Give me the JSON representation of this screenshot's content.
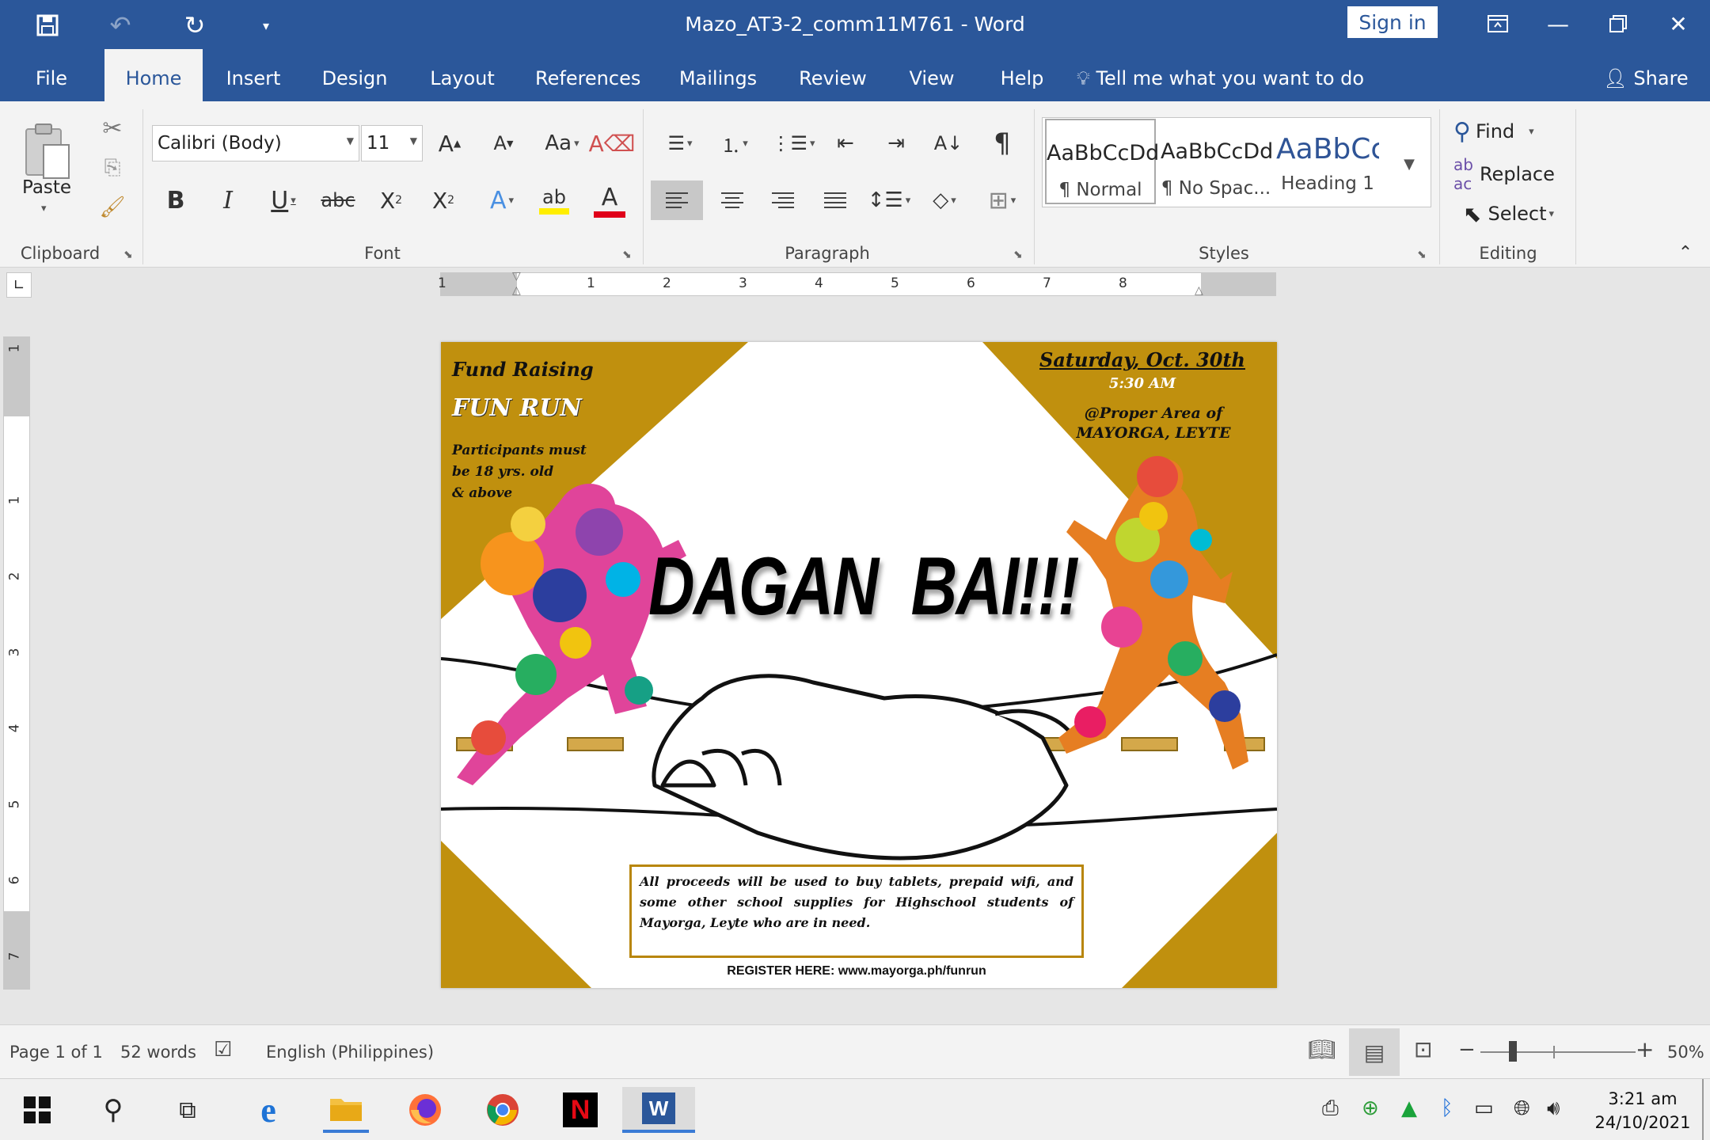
{
  "title_bar": {
    "document_title": "Mazo_AT3-2_comm11M761  -  Word",
    "sign_in_label": "Sign in",
    "quick_access": [
      "save-icon",
      "undo-icon",
      "redo-icon",
      "customize-qat-icon"
    ],
    "window_controls": [
      "ribbon-display-icon",
      "minimize-icon",
      "restore-icon",
      "close-icon"
    ]
  },
  "tabs": {
    "items": [
      "File",
      "Home",
      "Insert",
      "Design",
      "Layout",
      "References",
      "Mailings",
      "Review",
      "View",
      "Help"
    ],
    "active": "Home",
    "tell_me": "Tell me what you want to do",
    "share": "Share"
  },
  "ribbon": {
    "clipboard": {
      "label": "Clipboard",
      "paste_label": "Paste"
    },
    "font": {
      "label": "Font",
      "font_name": "Calibri (Body)",
      "font_size": "11"
    },
    "paragraph": {
      "label": "Paragraph"
    },
    "styles": {
      "label": "Styles",
      "items": [
        {
          "sample": "AaBbCcDd",
          "name": "¶ Normal"
        },
        {
          "sample": "AaBbCcDd",
          "name": "¶ No Spac..."
        },
        {
          "sample": "AaBbCc",
          "name": "Heading 1"
        }
      ]
    },
    "editing": {
      "label": "Editing",
      "find": "Find",
      "replace": "Replace",
      "select": "Select"
    }
  },
  "ruler": {
    "h_numbers": [
      "1",
      "1",
      "2",
      "3",
      "4",
      "5",
      "6",
      "7",
      "8"
    ],
    "v_numbers": [
      "1",
      "1",
      "2",
      "3",
      "4",
      "5",
      "6",
      "7"
    ]
  },
  "flyer": {
    "fund_raising": "Fund Raising",
    "fun_run": "FUN RUN",
    "participants": [
      "Participants must",
      "be 18 yrs. old",
      "& above"
    ],
    "date": "Saturday, Oct. 30th",
    "time": "5:30 AM",
    "venue": [
      "@Proper Area of",
      "MAYORGA, LEYTE"
    ],
    "headline": "DAGAN  BAI!!!",
    "proceeds": "All proceeds will be used to buy tablets, prepaid wifi, and some other school supplies for Highschool students of Mayorga, Leyte who are in need.",
    "register": "REGISTER HERE: www.mayorga.ph/funrun",
    "colors": {
      "gold": "#c0900e",
      "black": "#111111"
    }
  },
  "status_bar": {
    "page": "Page 1 of 1",
    "words": "52 words",
    "language": "English (Philippines)",
    "zoom_percent": "50%",
    "zoom_value": 50
  },
  "taskbar": {
    "apps": [
      "windows-start-icon",
      "search-icon",
      "task-view-icon",
      "edge-icon",
      "file-explorer-icon",
      "firefox-icon",
      "chrome-icon",
      "netflix-icon",
      "word-icon"
    ],
    "time": "3:21 am",
    "date": "24/10/2021"
  }
}
